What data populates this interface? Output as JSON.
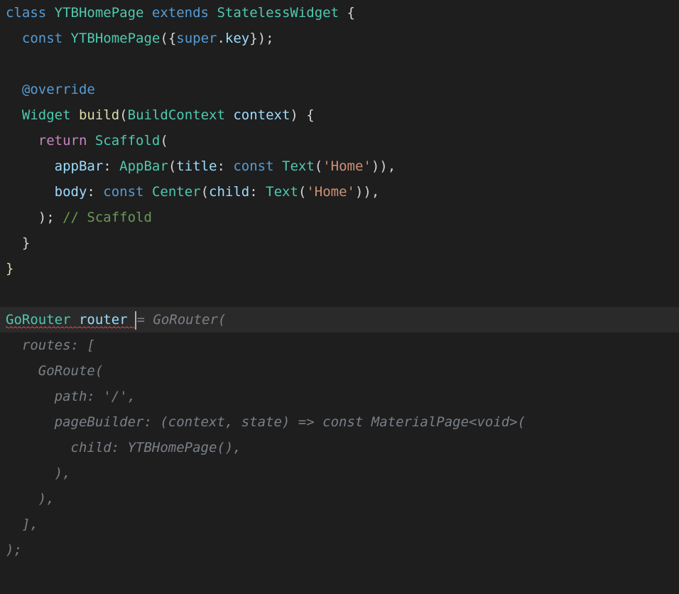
{
  "colors": {
    "background": "#1e1e1e",
    "current_line": "#2a2a2a",
    "keyword": "#569cd6",
    "type": "#4ec9b0",
    "punct": "#d4d4d4",
    "string": "#ce9178",
    "func": "#dcdcaa",
    "ident": "#9cdcfe",
    "flow": "#c586c0",
    "comment": "#6a9955",
    "ghost": "#7a8088",
    "error_squiggle": "#f14c4c"
  },
  "code": {
    "l1": {
      "t1": "class ",
      "t2": "YTBHomePage ",
      "t3": "extends ",
      "t4": "StatelessWidget ",
      "t5": "{"
    },
    "l2": {
      "indent": "  ",
      "t1": "const ",
      "t2": "YTBHomePage",
      "t3": "({",
      "t4": "super",
      "t5": ".",
      "t6": "key",
      "t7": "});"
    },
    "l3": {
      "blank": ""
    },
    "l4": {
      "indent": "  ",
      "t1": "@override"
    },
    "l5": {
      "indent": "  ",
      "t1": "Widget ",
      "t2": "build",
      "t3": "(",
      "t4": "BuildContext ",
      "t5": "context",
      "t6": ") {"
    },
    "l6": {
      "indent": "    ",
      "t1": "return ",
      "t2": "Scaffold",
      "t3": "("
    },
    "l7": {
      "indent": "      ",
      "t1": "appBar",
      "t2": ": ",
      "t3": "AppBar",
      "t4": "(",
      "t5": "title",
      "t6": ": ",
      "t7": "const ",
      "t8": "Text",
      "t9": "(",
      "t10": "'Home'",
      "t11": ")),"
    },
    "l8": {
      "indent": "      ",
      "t1": "body",
      "t2": ": ",
      "t3": "const ",
      "t4": "Center",
      "t5": "(",
      "t6": "child",
      "t7": ": ",
      "t8": "Text",
      "t9": "(",
      "t10": "'Home'",
      "t11": ")),"
    },
    "l9": {
      "indent": "    ",
      "t1": ");",
      "t2": " // Scaffold"
    },
    "l10": {
      "indent": "  ",
      "t1": "}"
    },
    "l11": {
      "t1": "}"
    },
    "l12": {
      "blank": ""
    },
    "l13": {
      "t1": "GoRouter ",
      "t2": "router ",
      "t3": "= GoRouter("
    },
    "g14": {
      "indent": "  ",
      "t1": "routes: ["
    },
    "g15": {
      "indent": "    ",
      "t1": "GoRoute("
    },
    "g16": {
      "indent": "      ",
      "t1": "path: '/',"
    },
    "g17": {
      "indent": "      ",
      "t1": "pageBuilder: (context, state) => const MaterialPage<void>("
    },
    "g18": {
      "indent": "        ",
      "t1": "child: YTBHomePage(),"
    },
    "g19": {
      "indent": "      ",
      "t1": "),"
    },
    "g20": {
      "indent": "    ",
      "t1": "),"
    },
    "g21": {
      "indent": "  ",
      "t1": "],"
    },
    "g22": {
      "t1": ");"
    }
  },
  "errors": [
    "GoRouter",
    "router"
  ],
  "cursor_line": 13
}
